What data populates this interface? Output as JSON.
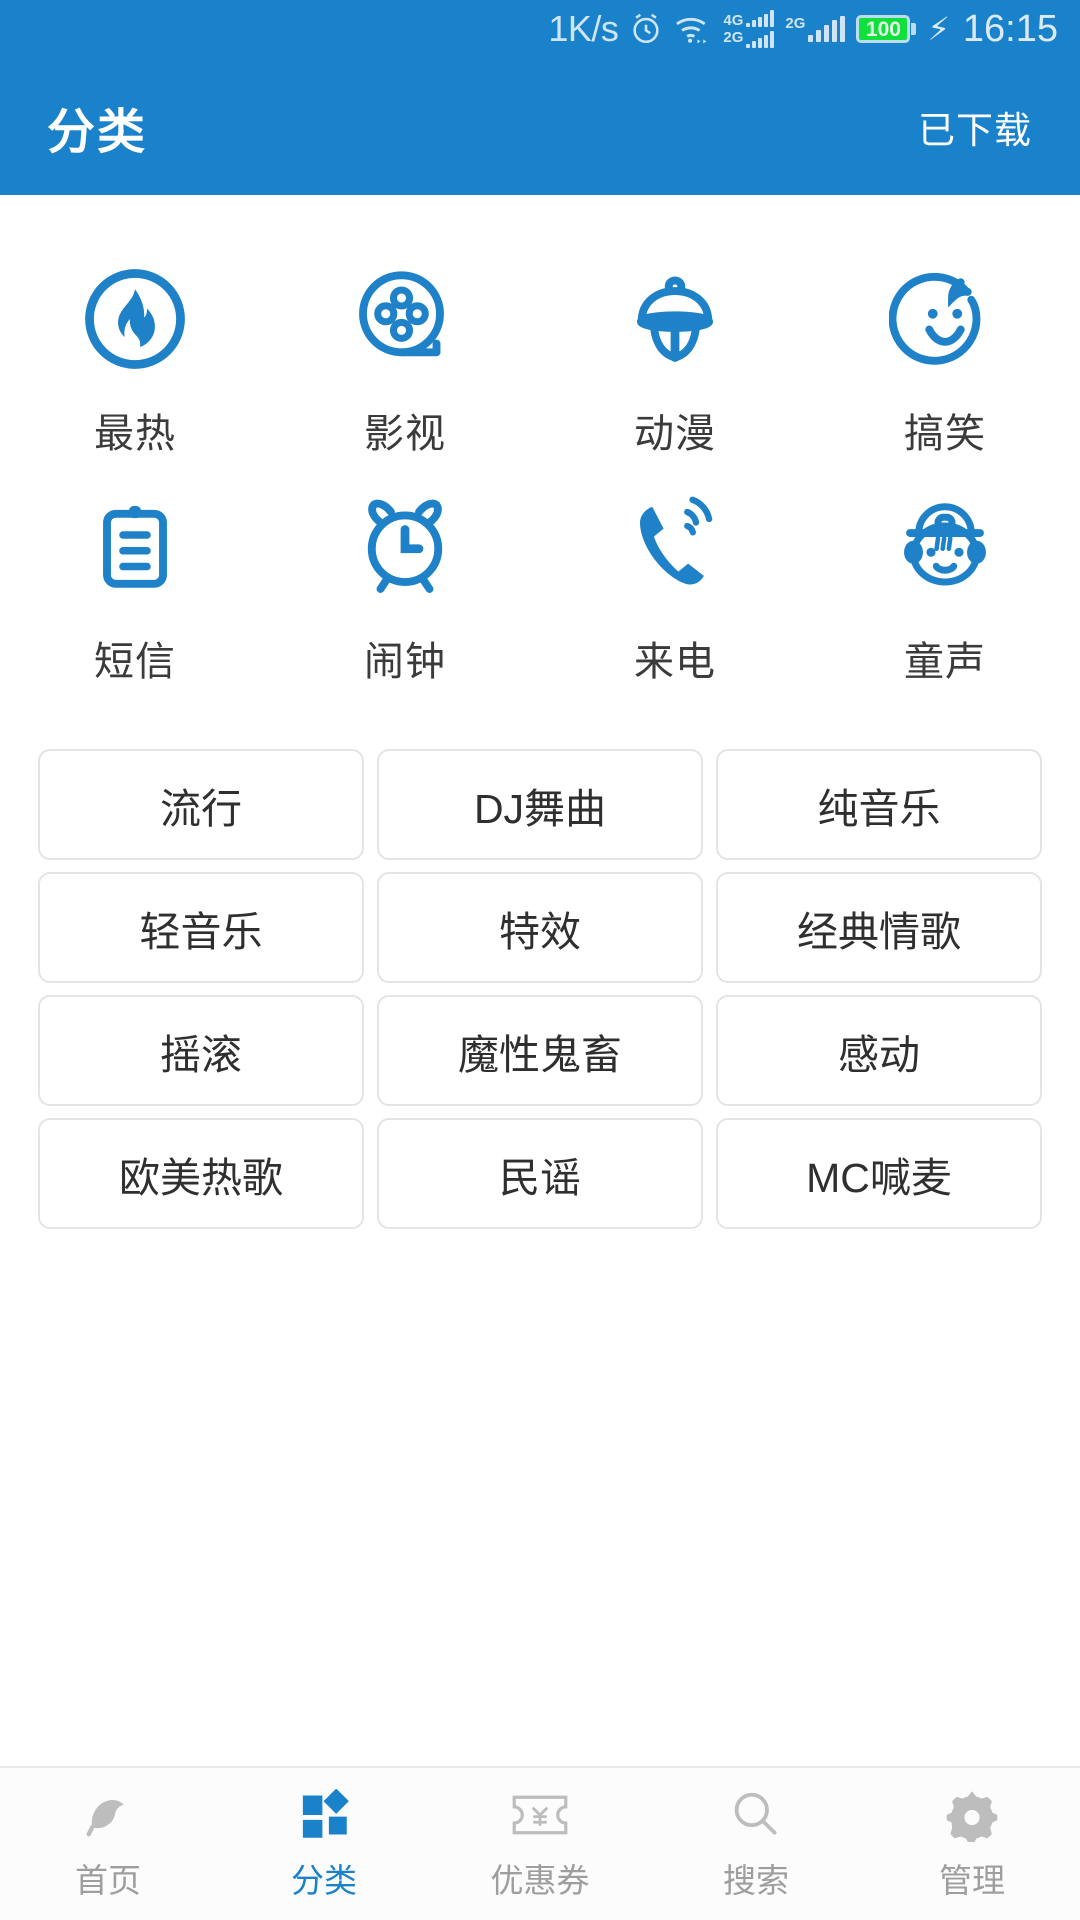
{
  "status_bar": {
    "network_speed": "1K/s",
    "alarm_icon": "alarm-clock-icon",
    "wifi_icon": "wifi-icon",
    "sim1_labels": [
      "4G",
      "2G"
    ],
    "sim2_label": "2G",
    "battery_level": "100",
    "charging_icon": "lightning-bolt-icon",
    "time": "16:15"
  },
  "app_bar": {
    "title": "分类",
    "action_label": "已下载"
  },
  "categories": [
    {
      "label": "最热",
      "icon": "fire-circle-icon"
    },
    {
      "label": "影视",
      "icon": "film-reel-icon"
    },
    {
      "label": "动漫",
      "icon": "anime-bell-icon"
    },
    {
      "label": "搞笑",
      "icon": "smiley-face-icon"
    },
    {
      "label": "短信",
      "icon": "sms-clipboard-icon"
    },
    {
      "label": "闹钟",
      "icon": "alarm-clock-icon"
    },
    {
      "label": "来电",
      "icon": "incoming-call-icon"
    },
    {
      "label": "童声",
      "icon": "child-face-icon"
    }
  ],
  "tags": [
    "流行",
    "DJ舞曲",
    "纯音乐",
    "轻音乐",
    "特效",
    "经典情歌",
    "摇滚",
    "魔性鬼畜",
    "感动",
    "欧美热歌",
    "民谣",
    "MC喊麦"
  ],
  "bottom_nav": [
    {
      "label": "首页",
      "icon": "home-star-icon",
      "active": false
    },
    {
      "label": "分类",
      "icon": "grid-squares-icon",
      "active": true
    },
    {
      "label": "优惠券",
      "icon": "coupon-icon",
      "active": false
    },
    {
      "label": "搜索",
      "icon": "search-icon",
      "active": false
    },
    {
      "label": "管理",
      "icon": "gear-icon",
      "active": false
    }
  ],
  "colors": {
    "brand_blue": "#1a82ca",
    "icon_blue": "#1f82c8",
    "nav_inactive": "#9e9e9e",
    "battery_green": "#0fe03c"
  }
}
